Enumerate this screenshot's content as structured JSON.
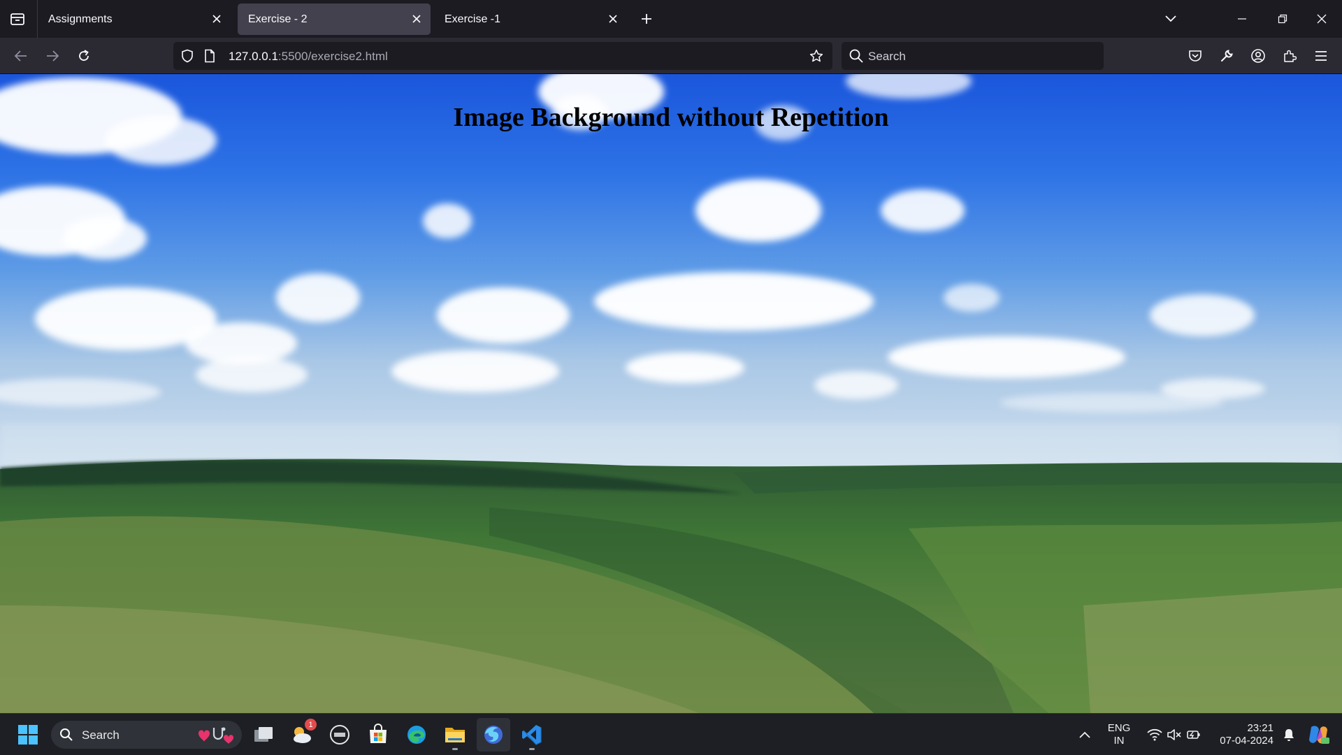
{
  "browser": {
    "tabs": [
      {
        "title": "Assignments",
        "active": false
      },
      {
        "title": "Exercise - 2",
        "active": true
      },
      {
        "title": "Exercise -1",
        "active": false
      }
    ],
    "url": {
      "host": "127.0.0.1",
      "rest": ":5500/exercise2.html"
    },
    "search_placeholder": "Search",
    "icons": {
      "tab_list": "tab-list-icon",
      "new_tab": "plus-icon",
      "list_all_tabs": "chevron-down-icon",
      "back": "arrow-left-icon",
      "forward": "arrow-right-icon",
      "reload": "reload-icon",
      "tracking_protection": "shield-icon",
      "page_info": "page-icon",
      "bookmark": "star-icon",
      "pocket": "pocket-icon",
      "tools": "wrench-icon",
      "account": "account-icon",
      "extensions": "puzzle-icon",
      "menu": "hamburger-icon"
    }
  },
  "page": {
    "heading": "Image Background without Repetition"
  },
  "taskbar": {
    "search_placeholder": "Search",
    "weather_badge": "1",
    "language": {
      "line1": "ENG",
      "line2": "IN"
    },
    "clock": {
      "time": "23:21",
      "date": "07-04-2024"
    }
  },
  "colors": {
    "tab_strip": "#1c1b22",
    "toolbar": "#2b2a33",
    "active_tab": "#42414d",
    "taskbar": "#1d1f24",
    "accent": "#4cc2ff"
  }
}
